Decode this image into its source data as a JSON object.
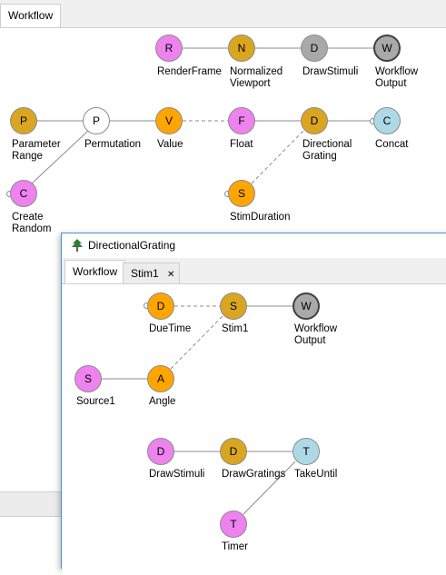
{
  "main": {
    "tab_label": "Workflow",
    "nodes": [
      {
        "id": "render-frame",
        "letter": "R",
        "label": "RenderFrame",
        "color": "#ee82ee"
      },
      {
        "id": "normalized-viewport",
        "letter": "N",
        "label": "Normalized\nViewport",
        "color": "#daa520"
      },
      {
        "id": "draw-stimuli",
        "letter": "D",
        "label": "DrawStimuli",
        "color": "#a9a9a9"
      },
      {
        "id": "workflow-output",
        "letter": "W",
        "label": "Workflow\nOutput",
        "color": "#a9a9a9"
      },
      {
        "id": "parameter-range",
        "letter": "P",
        "label": "Parameter\nRange",
        "color": "#daa520"
      },
      {
        "id": "permutation",
        "letter": "P",
        "label": "Permutation",
        "color": "#ffffff"
      },
      {
        "id": "value",
        "letter": "V",
        "label": "Value",
        "color": "#ffa500"
      },
      {
        "id": "float",
        "letter": "F",
        "label": "Float",
        "color": "#ee82ee"
      },
      {
        "id": "directional-grating",
        "letter": "D",
        "label": "Directional\nGrating",
        "color": "#daa520"
      },
      {
        "id": "concat",
        "letter": "C",
        "label": "Concat",
        "color": "#add8e6"
      },
      {
        "id": "create-random",
        "letter": "C",
        "label": "Create\nRandom",
        "color": "#ee82ee"
      },
      {
        "id": "stim-duration",
        "letter": "S",
        "label": "StimDuration",
        "color": "#ffa500"
      }
    ]
  },
  "dialog": {
    "title": "DirectionalGrating",
    "tabs": [
      {
        "label": "Workflow"
      },
      {
        "label": "Stim1"
      }
    ],
    "close_glyph": "✕",
    "nodes": [
      {
        "id": "due-time",
        "letter": "D",
        "label": "DueTime",
        "color": "#ffa500"
      },
      {
        "id": "stim1",
        "letter": "S",
        "label": "Stim1",
        "color": "#daa520"
      },
      {
        "id": "workflow-output",
        "letter": "W",
        "label": "Workflow\nOutput",
        "color": "#a9a9a9"
      },
      {
        "id": "source1",
        "letter": "S",
        "label": "Source1",
        "color": "#ee82ee"
      },
      {
        "id": "angle",
        "letter": "A",
        "label": "Angle",
        "color": "#ffa500"
      },
      {
        "id": "draw-stimuli",
        "letter": "D",
        "label": "DrawStimuli",
        "color": "#ee82ee"
      },
      {
        "id": "draw-gratings",
        "letter": "D",
        "label": "DrawGratings",
        "color": "#daa520"
      },
      {
        "id": "take-until",
        "letter": "T",
        "label": "TakeUntil",
        "color": "#add8e6"
      },
      {
        "id": "timer",
        "letter": "T",
        "label": "Timer",
        "color": "#ee82ee"
      }
    ]
  },
  "icons": {
    "dialog_icon": "tree-icon"
  }
}
